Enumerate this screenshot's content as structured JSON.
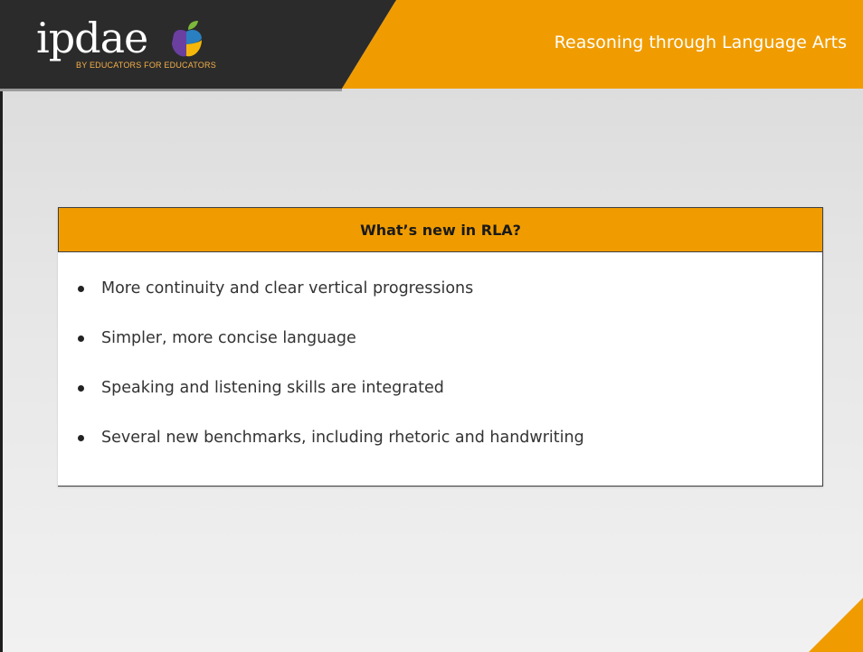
{
  "header": {
    "logo_text": "ipdae",
    "logo_tagline": "BY EDUCATORS FOR EDUCATORS",
    "title": "Reasoning through Language Arts"
  },
  "card": {
    "heading": "What’s new in RLA?",
    "bullets": [
      "More continuity and clear vertical progressions",
      "Simpler, more concise language",
      "Speaking and listening skills are integrated",
      "Several new benchmarks, including rhetoric and handwriting"
    ]
  },
  "colors": {
    "orange": "#f09c00",
    "dark": "#2b2b2b",
    "logo_tagline": "#f4b04a",
    "apple_purple": "#6a3fa0",
    "apple_blue": "#2a7fc0",
    "apple_yellow": "#f5b80a",
    "apple_leaf": "#7db83a"
  }
}
